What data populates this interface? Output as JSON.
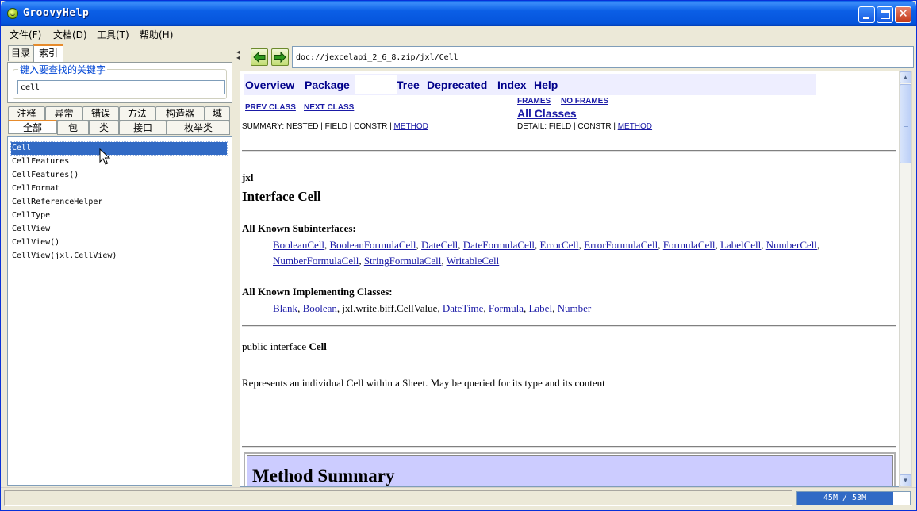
{
  "window": {
    "title": "GroovyHelp",
    "controls": {
      "minimize": "",
      "maximize": "",
      "close": "✕"
    }
  },
  "menu": [
    "文件(F)",
    "文档(D)",
    "工具(T)",
    "帮助(H)"
  ],
  "left_panel": {
    "top_tabs": [
      "目录",
      "索引"
    ],
    "selected_top_tab": "索引",
    "keyword_label": "键入要查找的关键字",
    "search_value": "cell",
    "filter_tabs_row1": [
      "注释",
      "异常",
      "错误",
      "方法",
      "构造器",
      "域"
    ],
    "filter_tabs_row2": [
      "全部",
      "包",
      "类",
      "接口",
      "枚举类"
    ],
    "selected_filter_tab": "全部",
    "results": [
      "Cell",
      "CellFeatures",
      "CellFeatures()",
      "CellFormat",
      "CellReferenceHelper",
      "CellType",
      "CellView",
      "CellView()",
      "CellView(jxl.CellView)"
    ],
    "selected_result": "Cell"
  },
  "address": "doc://jexcelapi_2_6_8.zip/jxl/Cell",
  "doc": {
    "nav_links": [
      "Overview",
      "Package",
      "Tree",
      "Deprecated",
      "Index",
      "Help"
    ],
    "prev_class": "PREV CLASS",
    "next_class": "NEXT CLASS",
    "frames": "FRAMES",
    "no_frames": "NO FRAMES",
    "all_classes": "All Classes",
    "summary_prefix": "SUMMARY: NESTED | FIELD | CONSTR | ",
    "summary_method": "METHOD",
    "detail_prefix": "DETAIL: FIELD | CONSTR | ",
    "detail_method": "METHOD",
    "package_name": "jxl",
    "title": "Interface Cell",
    "subinterfaces_heading": "All Known Subinterfaces:",
    "subinterfaces_line1": [
      "BooleanCell",
      "BooleanFormulaCell",
      "DateCell",
      "DateFormulaCell",
      "ErrorCell",
      "ErrorFormulaCell",
      "FormulaCell",
      "LabelCell",
      "NumberCell"
    ],
    "subinterfaces_line2": [
      "NumberFormulaCell",
      "StringFormulaCell",
      "WritableCell"
    ],
    "implementing_heading": "All Known Implementing Classes:",
    "implementing": [
      {
        "text": "Blank",
        "link": true
      },
      {
        "text": "Boolean",
        "link": true
      },
      {
        "text": "jxl.write.biff.CellValue",
        "link": false
      },
      {
        "text": "DateTime",
        "link": true
      },
      {
        "text": "Formula",
        "link": true
      },
      {
        "text": "Label",
        "link": true
      },
      {
        "text": "Number",
        "link": true
      }
    ],
    "declaration_prefix": "public interface ",
    "declaration_name": "Cell",
    "description": "Represents an individual Cell within a Sheet. May be queried for its type and its content",
    "method_summary": "Method Summary"
  },
  "status": {
    "memory_text": "45M / 53M",
    "memory_used_fraction": 0.849
  },
  "colors": {
    "selection": "#316ac5",
    "link": "#1a1aa6",
    "nav_bg": "#eeeeff",
    "summary_header_bg": "#ccccff"
  }
}
